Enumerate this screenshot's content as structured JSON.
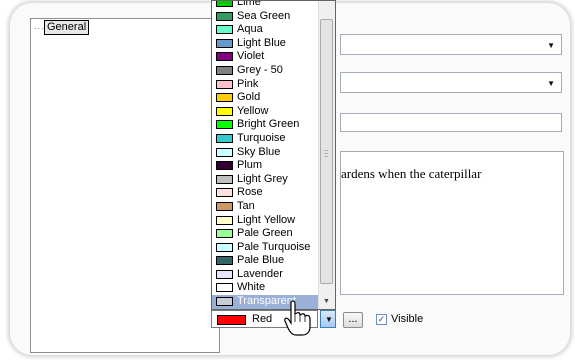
{
  "tree": {
    "dots": "....",
    "node_label": "General"
  },
  "memo": {
    "text": "ardens when the caterpillar"
  },
  "color_list": {
    "items": [
      {
        "name": "Lime",
        "color": "#00cc00"
      },
      {
        "name": "Sea Green",
        "color": "#339966"
      },
      {
        "name": "Aqua",
        "color": "#66ffcc"
      },
      {
        "name": "Light Blue",
        "color": "#6699cc"
      },
      {
        "name": "Violet",
        "color": "#800080"
      },
      {
        "name": "Grey - 50",
        "color": "#808080"
      },
      {
        "name": "Pink",
        "color": "#ffc0d0"
      },
      {
        "name": "Gold",
        "color": "#ffcc00"
      },
      {
        "name": "Yellow",
        "color": "#ffff00"
      },
      {
        "name": "Bright Green",
        "color": "#00ff00"
      },
      {
        "name": "Turquoise",
        "color": "#33cccc"
      },
      {
        "name": "Sky Blue",
        "color": "#ccffff"
      },
      {
        "name": "Plum",
        "color": "#330033"
      },
      {
        "name": "Light Grey",
        "color": "#c0c0c0"
      },
      {
        "name": "Rose",
        "color": "#ffe0e0"
      },
      {
        "name": "Tan",
        "color": "#cc9966"
      },
      {
        "name": "Light Yellow",
        "color": "#ffffcc"
      },
      {
        "name": "Pale Green",
        "color": "#99ff99"
      },
      {
        "name": "Pale Turquoise",
        "color": "#ccffff"
      },
      {
        "name": "Pale Blue",
        "color": "#336666"
      },
      {
        "name": "Lavender",
        "color": "#e6e6fa"
      },
      {
        "name": "White",
        "color": "#ffffff"
      },
      {
        "name": "Transparent",
        "color": "#c8ccd4",
        "selected": true
      }
    ]
  },
  "color_combo": {
    "label": "Red",
    "color": "#ff0000",
    "ellipsis": "..."
  },
  "visible_checkbox": {
    "label": "Visible",
    "checked": true,
    "mark": "✓"
  }
}
